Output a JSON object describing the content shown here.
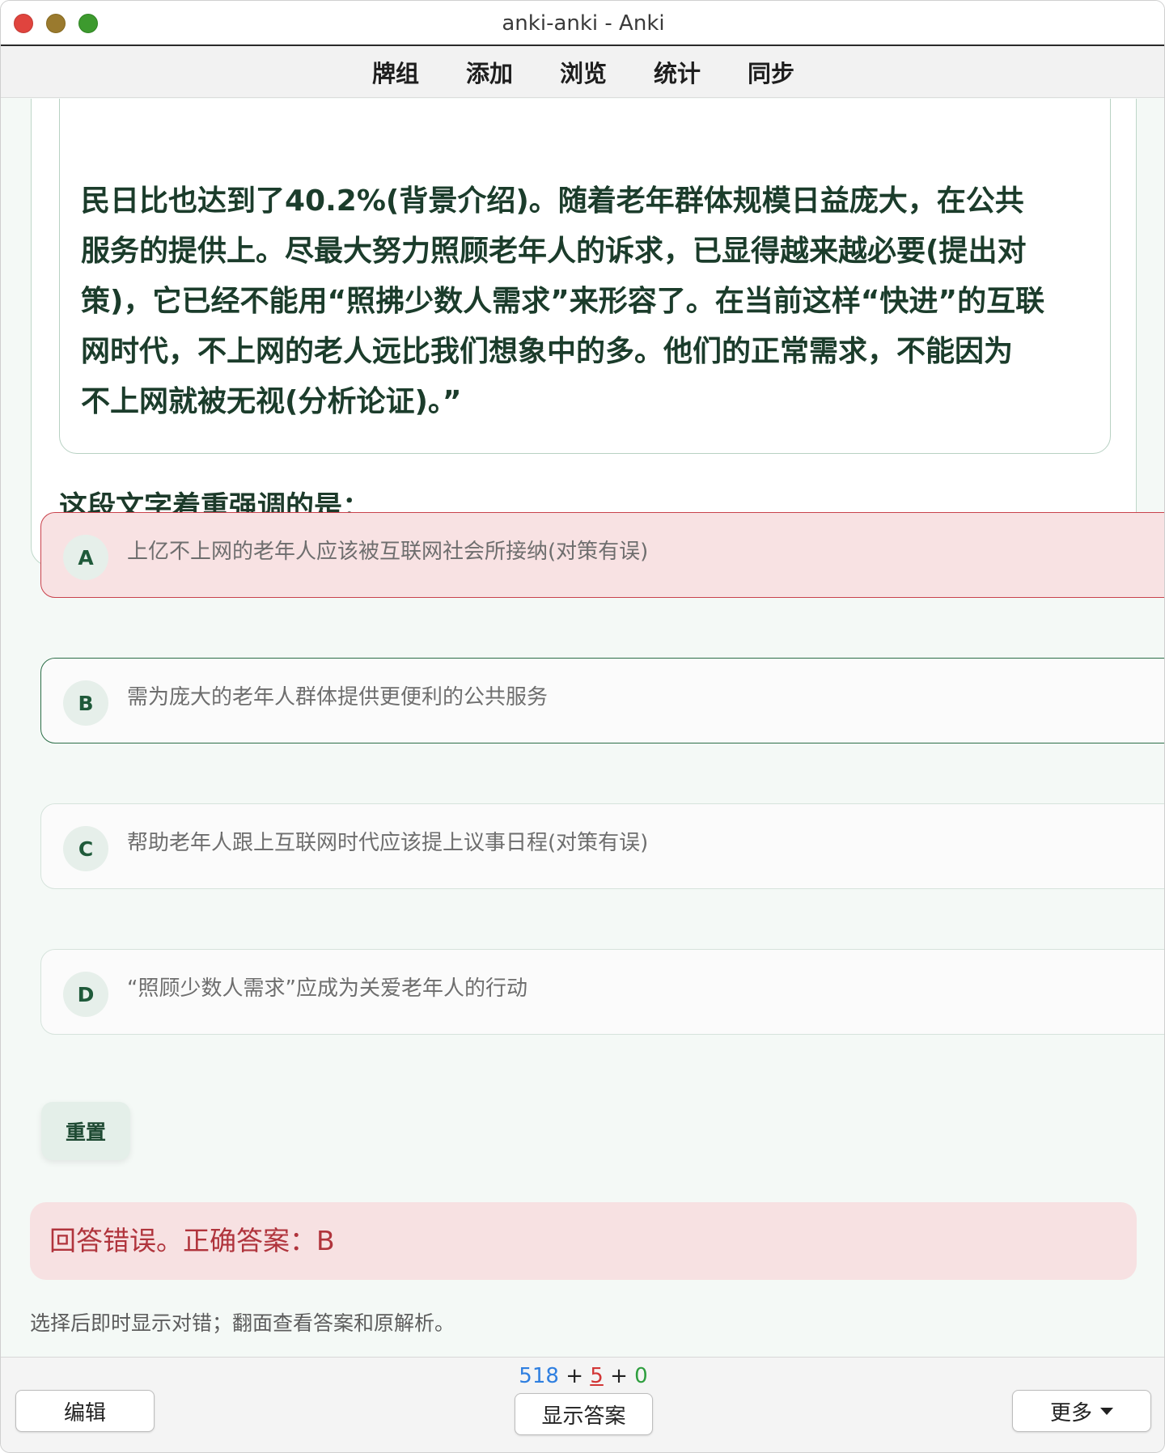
{
  "window": {
    "title": "anki-anki - Anki"
  },
  "toolbar": {
    "items": [
      "牌组",
      "添加",
      "浏览",
      "统计",
      "同步"
    ]
  },
  "card": {
    "passage_lines": [
      "民日比也达到了40.2%(背景介绍)。随着老年群体规模日益庞大，在公共",
      "服务的提供上。尽最大努力照顾老年人的诉求，已显得越来越必要(提出对",
      "策)，它已经不能用“照拂少数人需求”来形容了。在当前这样“快进”的互联",
      "网时代，不上网的老人远比我们想象中的多。他们的正常需求，不能因为",
      "不上网就被无视(分析论证)。”"
    ],
    "question": "这段文字着重强调的是："
  },
  "options": [
    {
      "letter": "A",
      "text": "上亿不上网的老年人应该被互联网社会所接纳(对策有误)",
      "state": "wrong"
    },
    {
      "letter": "B",
      "text": "需为庞大的老年人群体提供更便利的公共服务",
      "state": "correct"
    },
    {
      "letter": "C",
      "text": "帮助老年人跟上互联网时代应该提上议事日程(对策有误)",
      "state": "normal"
    },
    {
      "letter": "D",
      "text": "“照顾少数人需求”应成为关爱老年人的行动",
      "state": "normal"
    }
  ],
  "reset_label": "重置",
  "result_text": "回答错误。正确答案：B",
  "hint_text": "选择后即时显示对错；翻面查看答案和原解析。",
  "bottom": {
    "count_new": "518",
    "count_learn": "5",
    "count_review": "0",
    "plus": "+",
    "edit_label": "编辑",
    "show_answer_label": "显示答案",
    "more_label": "更多"
  },
  "colors": {
    "wrong_border": "#c9424c",
    "correct_border": "#2b6e47",
    "new_count": "#2f7fe0",
    "learn_count": "#d23636",
    "review_count": "#2e9e3e"
  }
}
